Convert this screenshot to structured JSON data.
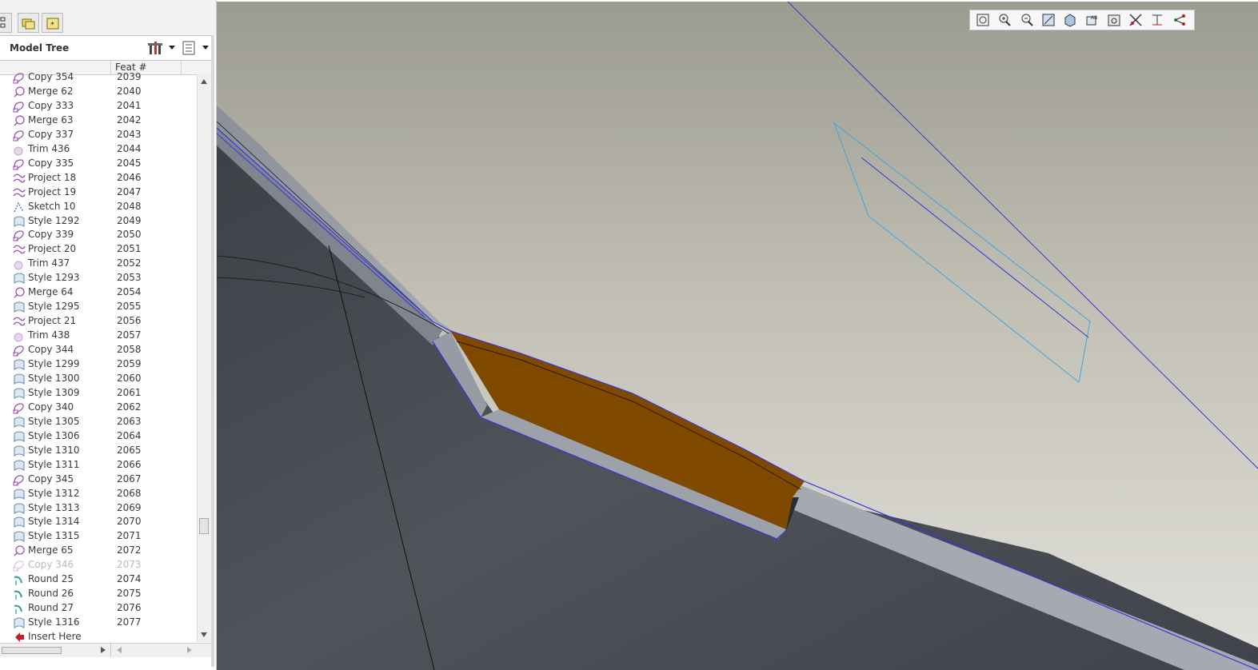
{
  "model_tree": {
    "title": "Model Tree",
    "column_feat": "Feat #",
    "rows": [
      {
        "name": "Copy 354",
        "feat": "2039",
        "icon": "copy-icon"
      },
      {
        "name": "Merge 62",
        "feat": "2040",
        "icon": "merge-icon"
      },
      {
        "name": "Copy 333",
        "feat": "2041",
        "icon": "copy-icon"
      },
      {
        "name": "Merge 63",
        "feat": "2042",
        "icon": "merge-icon"
      },
      {
        "name": "Copy 337",
        "feat": "2043",
        "icon": "copy-icon"
      },
      {
        "name": "Trim 436",
        "feat": "2044",
        "icon": "trim-icon"
      },
      {
        "name": "Copy 335",
        "feat": "2045",
        "icon": "copy-icon"
      },
      {
        "name": "Project 18",
        "feat": "2046",
        "icon": "project-icon"
      },
      {
        "name": "Project 19",
        "feat": "2047",
        "icon": "project-icon"
      },
      {
        "name": "Sketch 10",
        "feat": "2048",
        "icon": "sketch-icon"
      },
      {
        "name": "Style 1292",
        "feat": "2049",
        "icon": "style-icon"
      },
      {
        "name": "Copy 339",
        "feat": "2050",
        "icon": "copy-icon"
      },
      {
        "name": "Project 20",
        "feat": "2051",
        "icon": "project-icon"
      },
      {
        "name": "Trim 437",
        "feat": "2052",
        "icon": "trim-icon"
      },
      {
        "name": "Style 1293",
        "feat": "2053",
        "icon": "style-icon"
      },
      {
        "name": "Merge 64",
        "feat": "2054",
        "icon": "merge-icon"
      },
      {
        "name": "Style 1295",
        "feat": "2055",
        "icon": "style-icon"
      },
      {
        "name": "Project 21",
        "feat": "2056",
        "icon": "project-icon"
      },
      {
        "name": "Trim 438",
        "feat": "2057",
        "icon": "trim-icon"
      },
      {
        "name": "Copy 344",
        "feat": "2058",
        "icon": "copy-icon"
      },
      {
        "name": "Style 1299",
        "feat": "2059",
        "icon": "style-icon"
      },
      {
        "name": "Style 1300",
        "feat": "2060",
        "icon": "style-icon"
      },
      {
        "name": "Style 1309",
        "feat": "2061",
        "icon": "style-icon"
      },
      {
        "name": "Copy 340",
        "feat": "2062",
        "icon": "copy-icon"
      },
      {
        "name": "Style 1305",
        "feat": "2063",
        "icon": "style-icon"
      },
      {
        "name": "Style 1306",
        "feat": "2064",
        "icon": "style-icon"
      },
      {
        "name": "Style 1310",
        "feat": "2065",
        "icon": "style-icon"
      },
      {
        "name": "Style 1311",
        "feat": "2066",
        "icon": "style-icon"
      },
      {
        "name": "Copy 345",
        "feat": "2067",
        "icon": "copy-icon"
      },
      {
        "name": "Style 1312",
        "feat": "2068",
        "icon": "style-icon"
      },
      {
        "name": "Style 1313",
        "feat": "2069",
        "icon": "style-icon"
      },
      {
        "name": "Style 1314",
        "feat": "2070",
        "icon": "style-icon"
      },
      {
        "name": "Style 1315",
        "feat": "2071",
        "icon": "style-icon"
      },
      {
        "name": "Merge 65",
        "feat": "2072",
        "icon": "merge-icon"
      },
      {
        "name": "Copy 346",
        "feat": "2073",
        "icon": "copy-icon",
        "dimmed": true
      },
      {
        "name": "Round 25",
        "feat": "2074",
        "icon": "round-icon"
      },
      {
        "name": "Round 26",
        "feat": "2075",
        "icon": "round-icon"
      },
      {
        "name": "Round 27",
        "feat": "2076",
        "icon": "round-icon"
      },
      {
        "name": "Style 1316",
        "feat": "2077",
        "icon": "style-icon"
      },
      {
        "name": "Insert Here",
        "feat": "",
        "icon": "insert-arrow-icon"
      }
    ]
  },
  "view_toolbar": {
    "buttons": [
      "refit-icon",
      "zoom-in-icon",
      "zoom-out-icon",
      "repaint-icon",
      "display-style-icon",
      "saved-views-icon",
      "view-manager-icon",
      "datum-display-icon",
      "spin-center-icon",
      "annotation-display-icon"
    ]
  },
  "colors": {
    "feature_purple": "#9b4fb5",
    "style_blue": "#6b8fb3",
    "round_teal": "#2b9b9b",
    "highlight_orange": "#7f4a00",
    "edge_blue": "#3a32e0"
  }
}
